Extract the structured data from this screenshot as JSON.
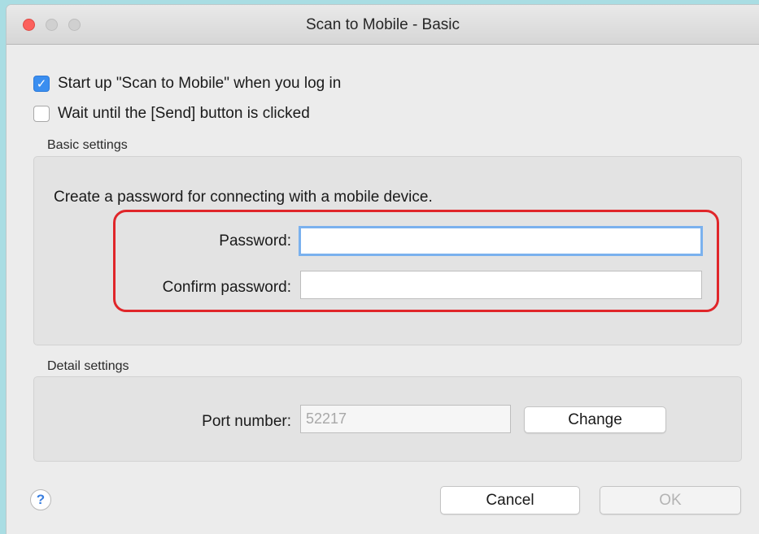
{
  "window": {
    "title": "Scan to Mobile - Basic"
  },
  "options": {
    "startup_label": "Start up \"Scan to Mobile\" when you log in",
    "startup_checked": true,
    "wait_label": "Wait until the [Send] button is clicked",
    "wait_checked": false
  },
  "basic": {
    "group_label": "Basic settings",
    "description": "Create a password for connecting with a mobile device.",
    "password_label": "Password:",
    "password_value": "",
    "confirm_label": "Confirm password:",
    "confirm_value": ""
  },
  "detail": {
    "group_label": "Detail settings",
    "port_label": "Port number:",
    "port_value": "52217",
    "change_label": "Change"
  },
  "footer": {
    "help_glyph": "?",
    "cancel_label": "Cancel",
    "ok_label": "OK"
  },
  "colors": {
    "accent": "#3a8ef0",
    "highlight": "#e0262a",
    "focus_ring": "#7ab1ee"
  },
  "icons": {
    "check": "✓"
  }
}
